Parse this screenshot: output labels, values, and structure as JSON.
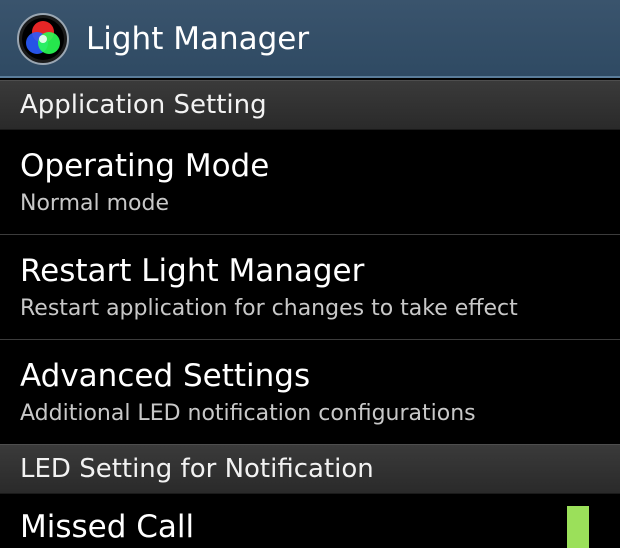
{
  "app": {
    "title": "Light Manager",
    "icon": "rgb-circles-icon"
  },
  "sections": {
    "application": {
      "title": "Application Setting"
    },
    "led": {
      "title": "LED Setting for Notification"
    }
  },
  "preferences": {
    "operating_mode": {
      "title": "Operating Mode",
      "summary": "Normal mode"
    },
    "restart": {
      "title": "Restart Light Manager",
      "summary": "Restart application for changes to take effect"
    },
    "advanced": {
      "title": "Advanced Settings",
      "summary": "Additional LED notification configurations"
    },
    "missed_call": {
      "title": "Missed Call",
      "led_color": "#9be05a"
    }
  },
  "colors": {
    "action_bar": "#344f68",
    "section_header": "#323232",
    "summary_text": "#c8c8c8"
  }
}
